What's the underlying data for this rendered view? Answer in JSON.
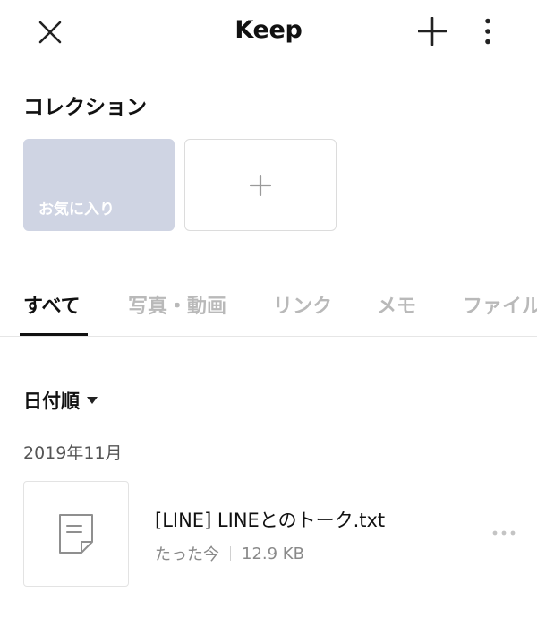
{
  "header": {
    "title": "Keep",
    "close_icon": "close-icon",
    "add_icon": "plus-icon",
    "more_icon": "more-vertical-icon"
  },
  "collections": {
    "title": "コレクション",
    "favorite_label": "お気に入り",
    "add_icon": "plus-icon",
    "favorite_color": "#cfd4e3"
  },
  "tabs": [
    {
      "label": "すべて",
      "active": true
    },
    {
      "label": "写真・動画",
      "active": false
    },
    {
      "label": "リンク",
      "active": false
    },
    {
      "label": "メモ",
      "active": false
    },
    {
      "label": "ファイル",
      "active": false
    }
  ],
  "sort": {
    "label": "日付順",
    "caret_icon": "caret-down-icon"
  },
  "groups": [
    {
      "date": "2019年11月",
      "items": [
        {
          "name": "[LINE] LINEとのトーク.txt",
          "time": "たった今",
          "size": "12.9 KB",
          "icon": "document-icon"
        }
      ]
    }
  ]
}
